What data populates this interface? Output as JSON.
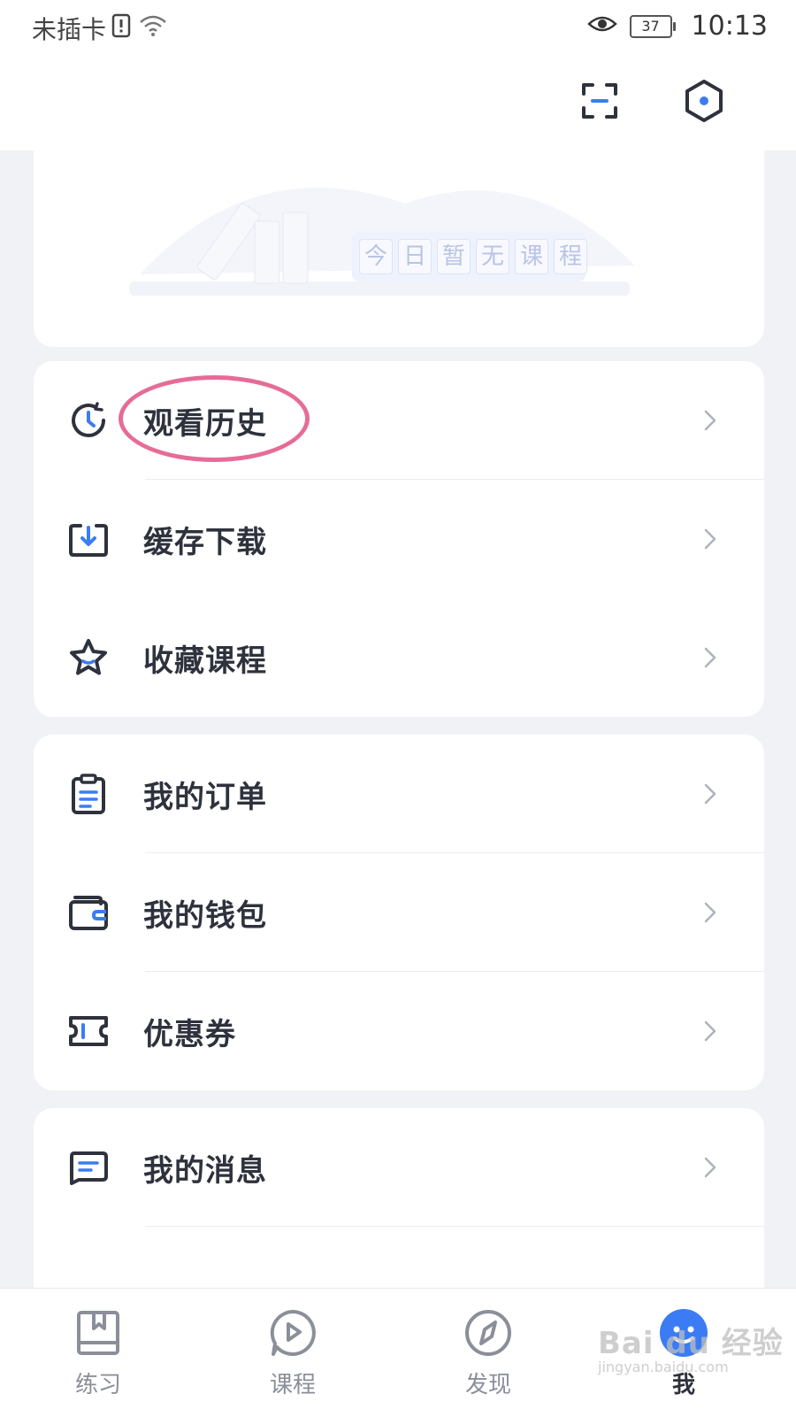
{
  "status_bar": {
    "carrier": "未插卡",
    "battery": "37",
    "time": "10:13"
  },
  "top_bar": {
    "scan_icon": "scan-icon",
    "settings_icon": "settings-hex-icon"
  },
  "course_card": {
    "empty_text": "今日暂无课程",
    "empty_chars": [
      "今",
      "日",
      "暂",
      "无",
      "课",
      "程"
    ]
  },
  "group1": [
    {
      "label": "观看历史",
      "icon": "history-clock-icon"
    },
    {
      "label": "缓存下载",
      "icon": "download-icon"
    },
    {
      "label": "收藏课程",
      "icon": "star-icon"
    }
  ],
  "group2": [
    {
      "label": "我的订单",
      "icon": "order-clipboard-icon"
    },
    {
      "label": "我的钱包",
      "icon": "wallet-icon"
    },
    {
      "label": "优惠券",
      "icon": "coupon-icon"
    }
  ],
  "group3": [
    {
      "label": "我的消息",
      "icon": "message-icon"
    }
  ],
  "tabs": [
    {
      "label": "练习",
      "icon": "practice-book-icon"
    },
    {
      "label": "课程",
      "icon": "course-play-icon"
    },
    {
      "label": "发现",
      "icon": "discover-compass-icon"
    },
    {
      "label": "我",
      "icon": "me-avatar-icon"
    }
  ],
  "watermark": {
    "logo": "Bai du 经验",
    "url": "jingyan.baidu.com"
  },
  "colors": {
    "accent": "#3b7cf5",
    "highlight": "#e66c97",
    "text": "#2e323d"
  }
}
